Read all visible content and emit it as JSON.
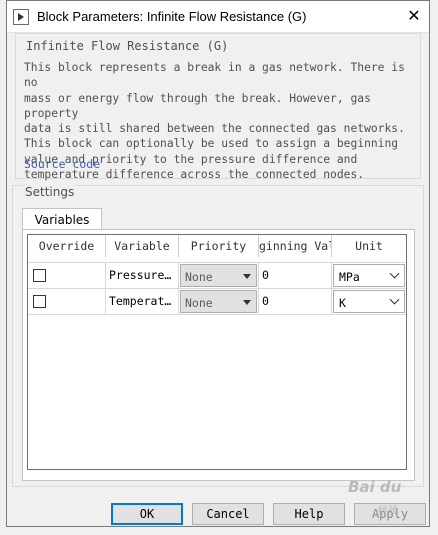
{
  "window": {
    "title": "Block Parameters: Infinite Flow Resistance (G)",
    "close_glyph": "✕"
  },
  "description": {
    "title": "Infinite Flow Resistance (G)",
    "text": "This block represents a break in a gas network. There is no\nmass or energy flow through the break. However, gas property\ndata is still shared between the connected gas networks.\nThis block can optionally be used to assign a beginning\nvalue and priority to the pressure difference and\ntemperature difference across the connected nodes.",
    "source_link": "Source code"
  },
  "settings": {
    "label": "Settings",
    "tabs": [
      {
        "label": "Variables",
        "active": true
      }
    ],
    "table": {
      "columns": [
        "Override",
        "Variable",
        "Priority",
        "Beginning Value",
        "Unit"
      ],
      "columns_visible": [
        "Override",
        "Variable",
        "Priority",
        "ginning Val",
        "Unit"
      ],
      "rows": [
        {
          "override": false,
          "variable": "Pressure…",
          "priority": "None",
          "beginning_value": "0",
          "unit": "MPa"
        },
        {
          "override": false,
          "variable": "Temperat…",
          "priority": "None",
          "beginning_value": "0",
          "unit": "K"
        }
      ]
    }
  },
  "buttons": {
    "ok": "OK",
    "cancel": "Cancel",
    "help": "Help",
    "apply": "Apply"
  },
  "watermark": {
    "logo_text": "Bai du",
    "sub_text": "经验"
  },
  "icons": {
    "app": "simulink-block-icon",
    "close": "close-icon",
    "priority_dropdown": "triangle-down-icon",
    "unit_dropdown": "chevron-down-icon"
  },
  "colors": {
    "dialog_bg": "#f0f0f0",
    "link": "#3a5fb0",
    "ok_border": "#0078d7"
  }
}
